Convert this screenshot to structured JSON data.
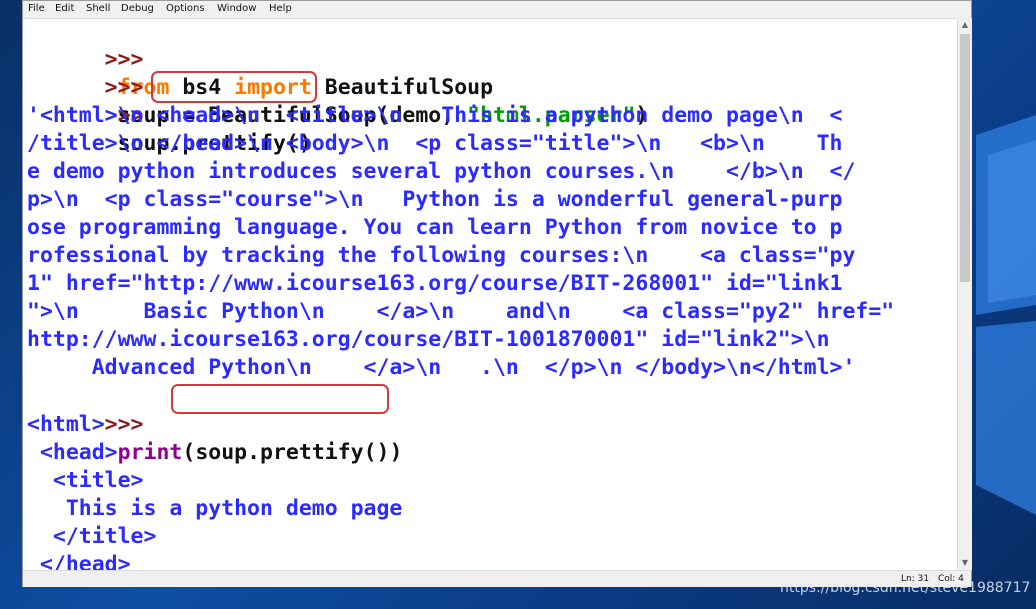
{
  "menu": {
    "items": [
      "File",
      "Edit",
      "Shell",
      "Debug",
      "Options",
      "Window",
      "Help"
    ]
  },
  "shell": {
    "prompt": ">>>",
    "cmd1": {
      "kw_from": "from",
      "module": " bs4 ",
      "kw_import": "import",
      "name": " BeautifulSoup"
    },
    "cmd2": {
      "lhs": "soup = BeautifulSoup(demo, ",
      "arg": "\"html.parser\"",
      "end": ")"
    },
    "cmd3": {
      "obj": "soup.",
      "call": "prettify()"
    },
    "output_lines": [
      "'<html>\\n <head>\\n  <title>\\n   This is a python demo page\\n  <",
      "/title>\\n </head>\\n <body>\\n  <p class=\"title\">\\n   <b>\\n    Th",
      "e demo python introduces several python courses.\\n    </b>\\n  </",
      "p>\\n  <p class=\"course\">\\n   Python is a wonderful general-purp",
      "ose programming language. You can learn Python from novice to p",
      "rofessional by tracking the following courses:\\n    <a class=\"py",
      "1\" href=\"http://www.icourse163.org/course/BIT-268001\" id=\"link1",
      "\">\\n     Basic Python\\n    </a>\\n    and\\n    <a class=\"py2\" href=\"",
      "http://www.icourse163.org/course/BIT-1001870001\" id=\"link2\">\\n",
      "     Advanced Python\\n    </a>\\n   .\\n  </p>\\n </body>\\n</html>'"
    ],
    "cmd4": {
      "fn": "print",
      "open": "(",
      "arg": "soup.prettify()",
      "close": ")"
    },
    "print_lines": [
      "<html>",
      " <head>",
      "  <title>",
      "   This is a python demo page",
      "  </title>",
      " </head>"
    ]
  },
  "status": {
    "ln": "Ln: 31",
    "col": "Col: 4"
  },
  "watermark": "https://blog.csdn.net/steve1988717",
  "colors": {
    "prompt": "#8b1a1a",
    "keyword": "#ff7700",
    "string": "#00a000",
    "builtin": "#900090",
    "output": "#2b2bff",
    "highlight": "#d23b3b"
  }
}
